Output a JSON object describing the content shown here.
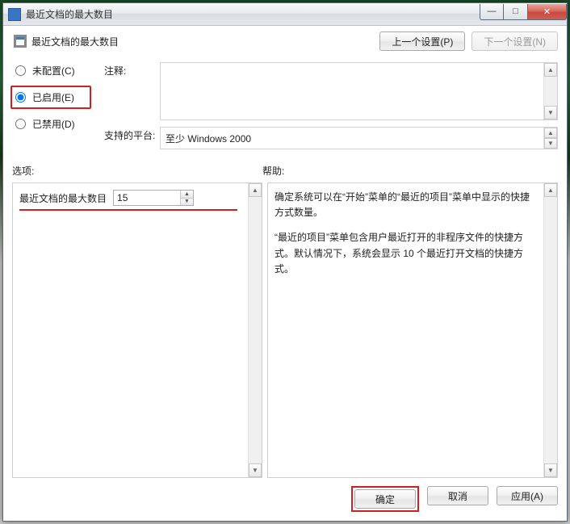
{
  "title": "最近文档的最大数目",
  "header": {
    "title": "最近文档的最大数目",
    "prev": "上一个设置(P)",
    "next": "下一个设置(N)"
  },
  "radios": {
    "notConfigured": "未配置(C)",
    "enabled": "已启用(E)",
    "disabled": "已禁用(D)"
  },
  "labels": {
    "comment": "注释:",
    "platform": "支持的平台:",
    "options": "选项:",
    "help": "帮助:"
  },
  "platform_value": "至少 Windows 2000",
  "option": {
    "label": "最近文档的最大数目",
    "value": "15"
  },
  "help": {
    "p1": "确定系统可以在“开始”菜单的“最近的项目”菜单中显示的快捷方式数量。",
    "p2": "“最近的项目”菜单包含用户最近打开的非程序文件的快捷方式。默认情况下，系统会显示 10 个最近打开文档的快捷方式。"
  },
  "buttons": {
    "ok": "确定",
    "cancel": "取消",
    "apply": "应用(A)"
  }
}
